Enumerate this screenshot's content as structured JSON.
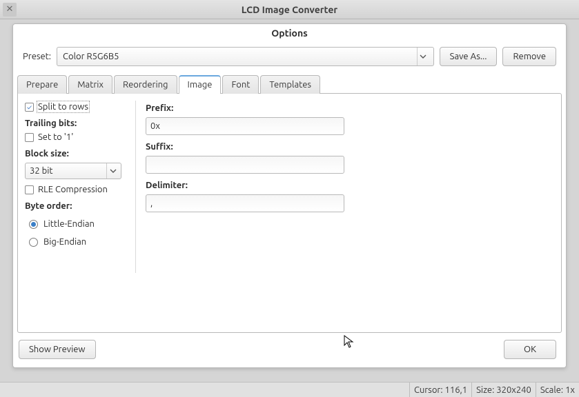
{
  "window": {
    "title": "LCD Image Converter"
  },
  "dialog": {
    "title": "Options",
    "preset_label": "Preset:",
    "preset_value": "Color R5G6B5",
    "save_as": "Save As...",
    "remove": "Remove",
    "tabs": [
      "Prepare",
      "Matrix",
      "Reordering",
      "Image",
      "Font",
      "Templates"
    ],
    "active_tab": "Image"
  },
  "image_tab": {
    "split_to_rows": {
      "label": "Split to rows",
      "checked": true
    },
    "trailing_bits_label": "Trailing bits:",
    "set_to_1": {
      "label": "Set to '1'",
      "checked": false
    },
    "block_size_label": "Block size:",
    "block_size_value": "32 bit",
    "rle": {
      "label": "RLE Compression",
      "checked": false
    },
    "byte_order_label": "Byte order:",
    "byte_order_options": [
      "Little-Endian",
      "Big-Endian"
    ],
    "byte_order_selected": "Little-Endian",
    "prefix_label": "Prefix:",
    "prefix_value": "0x",
    "suffix_label": "Suffix:",
    "suffix_value": "",
    "delimiter_label": "Delimiter:",
    "delimiter_value": ","
  },
  "footer": {
    "show_preview": "Show Preview",
    "ok": "OK"
  },
  "statusbar": {
    "cursor": "Cursor: 116,1",
    "size": "Size: 320x240",
    "scale": "Scale: 1x"
  }
}
